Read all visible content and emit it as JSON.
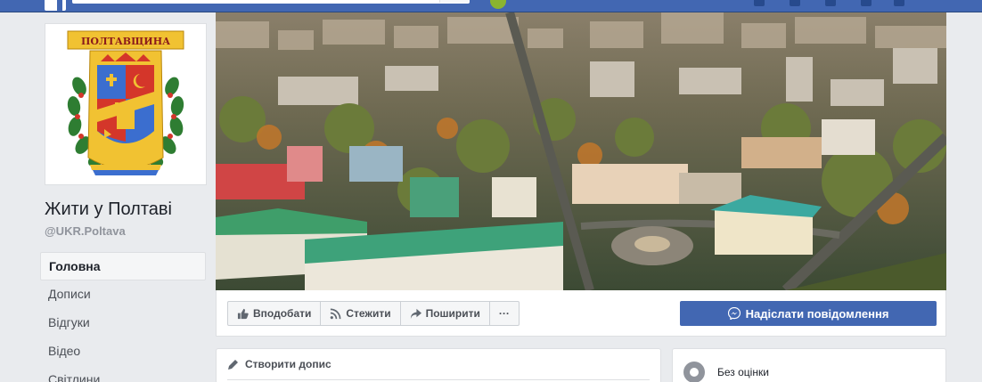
{
  "page": {
    "name": "Жити у Полтаві",
    "handle": "@UKR.Poltava"
  },
  "logo": {
    "banner_text": "ПОЛТАВЩИНА"
  },
  "nav": {
    "items": [
      {
        "label": "Головна",
        "active": true
      },
      {
        "label": "Дописи",
        "active": false
      },
      {
        "label": "Відгуки",
        "active": false
      },
      {
        "label": "Відео",
        "active": false
      },
      {
        "label": "Світлини",
        "active": false
      }
    ]
  },
  "actions": {
    "like_label": "Вподобати",
    "follow_label": "Стежити",
    "share_label": "Поширити",
    "more_label": "···",
    "message_label": "Надіслати повідомлення"
  },
  "composer": {
    "title": "Створити допис"
  },
  "rating": {
    "label": "Без оцінки"
  },
  "colors": {
    "facebook_blue": "#4267b2",
    "background": "#e9ebee",
    "crest_gold": "#f1c232",
    "crest_red": "#d4362a",
    "crest_blue": "#3b6ecf"
  },
  "icons": {
    "like": "thumbs-up-icon",
    "follow": "rss-icon",
    "share": "share-arrow-icon",
    "message": "messenger-icon",
    "composer": "pencil-icon",
    "rating": "rating-icon"
  }
}
